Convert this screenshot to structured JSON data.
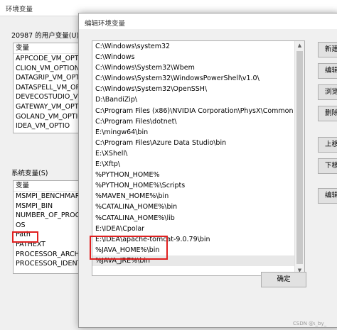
{
  "parent": {
    "title": "环境变量",
    "user_section_label": "20987 的用户变量(U)",
    "user_table": {
      "header": "变量",
      "rows": [
        "APPCODE_VM_OPTIO",
        "CLION_VM_OPTIONS",
        "DATAGRIP_VM_OPT",
        "DATASPELL_VM_OP",
        "DEVECOSTUDIO_VM",
        "GATEWAY_VM_OPTIC",
        "GOLAND_VM_OPTIC",
        "IDEA_VM_OPTIO"
      ]
    },
    "system_section_label": "系统变量(S)",
    "system_table": {
      "header": "变量",
      "rows": [
        "MSMPI_BENCHMAR",
        "MSMPI_BIN",
        "NUMBER_OF_PROCE",
        "OS",
        "Path",
        "PATHEXT",
        "PROCESSOR_ARCHIT",
        "PROCESSOR_IDENTI"
      ]
    },
    "ok_label": "确定"
  },
  "dialog": {
    "title": "编辑环境变量",
    "entries": [
      "C:\\Windows\\system32",
      "C:\\Windows",
      "C:\\Windows\\System32\\Wbem",
      "C:\\Windows\\System32\\WindowsPowerShell\\v1.0\\",
      "C:\\Windows\\System32\\OpenSSH\\",
      "D:\\BandiZip\\",
      "C:\\Program Files (x86)\\NVIDIA Corporation\\PhysX\\Common",
      "C:\\Program Files\\dotnet\\",
      "E:\\mingw64\\bin",
      "C:\\Program Files\\Azure Data Studio\\bin",
      "E:\\XShell\\",
      "E:\\Xftp\\",
      "%PYTHON_HOME%",
      "%PYTHON_HOME%\\Scripts",
      "%MAVEN_HOME%\\bin",
      "%CATALINA_HOME%\\bin",
      "%CATALINA_HOME%\\lib",
      "E:\\IDEA\\Cpolar",
      "E:\\IDEA\\apache-tomcat-9.0.79\\bin",
      "%JAVA_HOME%\\bin",
      "%JAVA_JRE%\\bin"
    ],
    "buttons": {
      "new": "新建",
      "edit": "编辑",
      "browse": "浏览",
      "delete": "删除",
      "move_up": "上移",
      "move_down": "下移",
      "edit_text": "编辑文"
    },
    "ok_label": "确定"
  },
  "watermark": "CSDN @ι_by_"
}
